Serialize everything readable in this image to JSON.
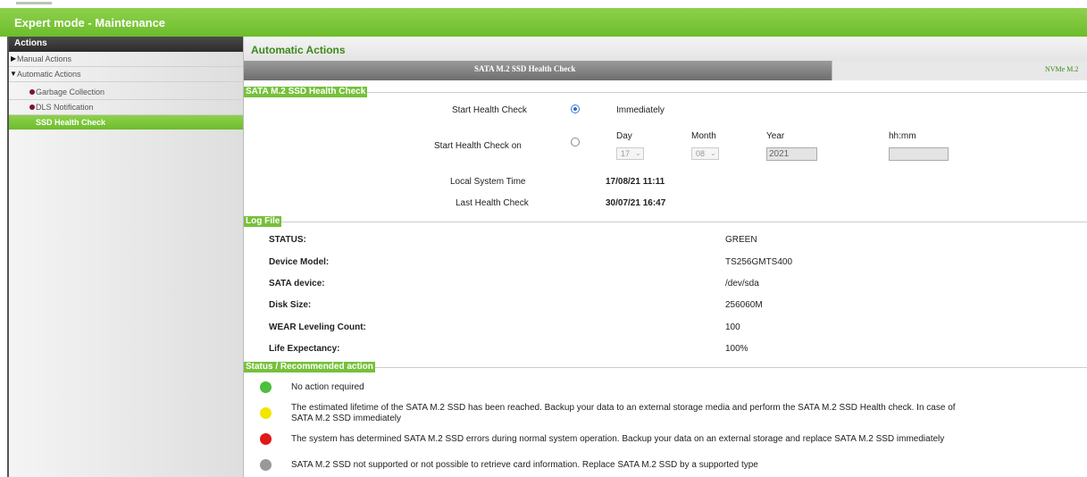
{
  "window": {
    "title": "Expert mode - Maintenance"
  },
  "sidebar": {
    "header": "Actions",
    "items": [
      {
        "label": "Manual Actions",
        "marker": "triangle-right"
      },
      {
        "label": "Automatic Actions",
        "marker": "triangle-down"
      },
      {
        "label": "Garbage Collection",
        "marker": "dot"
      },
      {
        "label": "DLS Notification",
        "marker": "dot"
      },
      {
        "label": "SSD Health Check",
        "marker": "none",
        "selected": true
      }
    ]
  },
  "main": {
    "title": "Automatic Actions",
    "tabs": [
      {
        "label": "SATA M.2 SSD Health Check",
        "active": true
      },
      {
        "label": "NVMe M.2",
        "active": false
      }
    ]
  },
  "health_check": {
    "section_title": "SATA M.2 SSD Health Check",
    "start_label": "Start Health Check",
    "immediately_label": "Immediately",
    "start_on_label": "Start Health Check on",
    "day_label": "Day",
    "month_label": "Month",
    "year_label": "Year",
    "time_label": "hh:mm",
    "day_value": "17",
    "month_value": "08",
    "year_value": "2021",
    "time_value": "",
    "selected_option": "Immediately",
    "local_time_label": "Local System Time",
    "local_time_value": "17/08/21 11:11",
    "last_check_label": "Last Health Check",
    "last_check_value": "30/07/21 16:47"
  },
  "log": {
    "section_title": "Log File",
    "rows": [
      {
        "label": "STATUS:",
        "value": "GREEN"
      },
      {
        "label": "Device Model:",
        "value": "TS256GMTS400"
      },
      {
        "label": "SATA device:",
        "value": "/dev/sda"
      },
      {
        "label": "Disk Size:",
        "value": "256060M"
      },
      {
        "label": "WEAR Leveling Count:",
        "value": "100"
      },
      {
        "label": "Life Expectancy:",
        "value": "100%"
      }
    ]
  },
  "status": {
    "section_title": "Status / Recommended action",
    "items": [
      {
        "color": "#4cbf3c",
        "line1": "No action required",
        "line2": ""
      },
      {
        "color": "#f2e600",
        "line1": "The estimated lifetime of the SATA M.2 SSD has been reached. Backup your data to an external storage media and perform the SATA M.2 SSD Health check. In case of",
        "line2": "SATA M.2 SSD immediately"
      },
      {
        "color": "#e01818",
        "line1": "The system has determined SATA M.2 SSD errors during normal system operation. Backup your data on an external storage and replace SATA M.2 SSD immediately",
        "line2": ""
      },
      {
        "color": "#999999",
        "line1": "SATA M.2 SSD not supported or not possible to retrieve card information. Replace SATA M.2 SSD by a supported type",
        "line2": ""
      }
    ]
  },
  "colors": {
    "accent_green": "#76c03a",
    "sidebar_header": "#333333",
    "bullet": "#7a1626"
  }
}
